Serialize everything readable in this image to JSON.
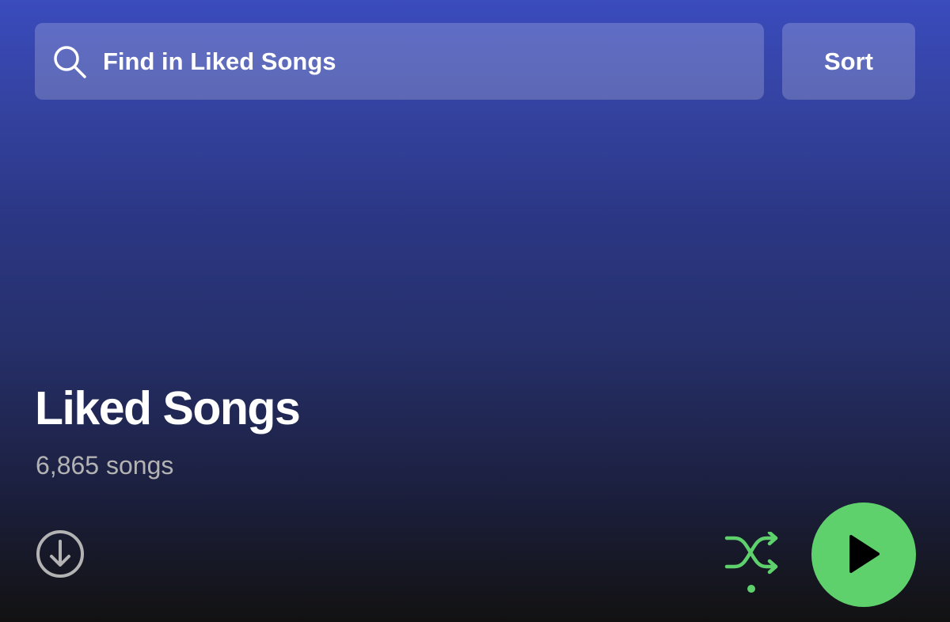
{
  "header": {
    "search": {
      "placeholder": "Find in Liked Songs",
      "value": "",
      "icon": "search-icon"
    },
    "sort_label": "Sort"
  },
  "playlist": {
    "title": "Liked Songs",
    "song_count": "6,865 songs"
  },
  "controls": {
    "download_icon": "download-icon",
    "shuffle_icon": "shuffle-icon",
    "play_icon": "play-icon"
  },
  "colors": {
    "accent_green": "#5fd16c",
    "gradient_top": "#3a4bbd",
    "gradient_bottom": "#121212",
    "secondary_text": "#b3b3b3"
  }
}
